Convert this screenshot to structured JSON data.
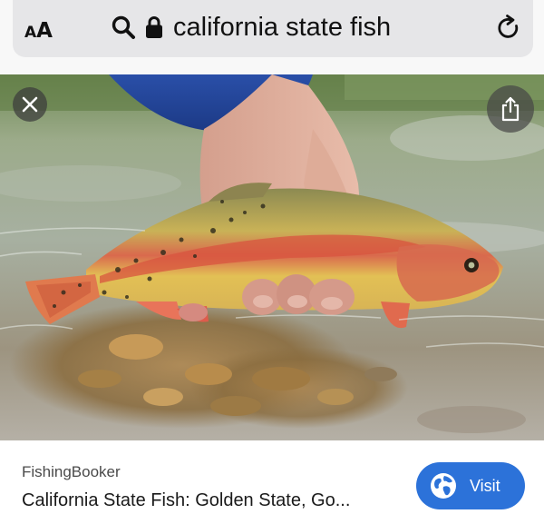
{
  "browser": {
    "text_size_label_small": "A",
    "text_size_label_large": "A",
    "url_text": "california state fish",
    "icons": {
      "text_size": "text-size-icon",
      "search": "search-icon",
      "lock": "lock-icon",
      "reload": "reload-icon"
    }
  },
  "image_viewer": {
    "icons": {
      "close": "close-icon",
      "share": "share-icon"
    }
  },
  "result": {
    "source": "FishingBooker",
    "title": "California State Fish: Golden State, Go...",
    "visit_label": "Visit",
    "visit_icon": "globe-icon",
    "accent_color": "#2c72d9"
  }
}
